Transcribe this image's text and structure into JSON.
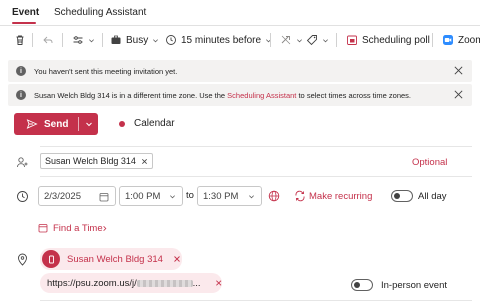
{
  "tabs": [
    {
      "label": "Event",
      "active": true
    },
    {
      "label": "Scheduling Assistant",
      "active": false
    }
  ],
  "toolbar": {
    "busy_label": "Busy",
    "reminder_label": "15 minutes before",
    "scheduling_poll_label": "Scheduling poll",
    "zoom_label": "Zoom"
  },
  "infobars": {
    "not_sent": "You haven't sent this meeting invitation yet.",
    "timezone_prefix": "Susan Welch Bldg 314 is in a different time zone. Use the ",
    "timezone_link": "Scheduling Assistant",
    "timezone_suffix": " to select times across time zones."
  },
  "send": {
    "label": "Send"
  },
  "calendar_label": "Calendar",
  "attendees": {
    "chips": [
      "Susan Welch Bldg 314"
    ],
    "optional_label": "Optional"
  },
  "datetime": {
    "date": "2/3/2025",
    "start_time": "1:00 PM",
    "to_label": "to",
    "end_time": "1:30 PM",
    "make_recurring_label": "Make recurring",
    "all_day_label": "All day"
  },
  "find_time_label": "Find a Time",
  "location": {
    "room_label": "Susan Welch Bldg 314",
    "url_prefix": "https://psu.zoom.us/j/",
    "url_suffix": "...",
    "in_person_label": "In-person event"
  },
  "colors": {
    "accent": "#c4314b",
    "chip_bg": "#fbe9ec",
    "infobar_bg": "#f3f2f1"
  }
}
